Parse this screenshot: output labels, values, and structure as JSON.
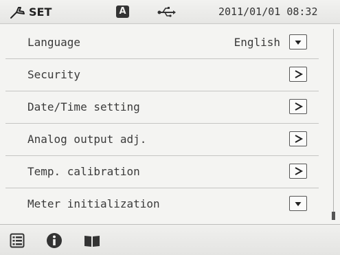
{
  "status_bar": {
    "set_icon": "wrench-icon",
    "title": "SET",
    "mode_badge": "A",
    "usb_icon": "usb-icon",
    "datetime": "2011/01/01 08:32"
  },
  "menu": {
    "items": [
      {
        "label": "Language",
        "value": "English",
        "control_icon": "dropdown-arrow-icon"
      },
      {
        "label": "Security",
        "value": "",
        "control_icon": "chevron-right-icon"
      },
      {
        "label": "Date/Time setting",
        "value": "",
        "control_icon": "chevron-right-icon"
      },
      {
        "label": "Analog output adj.",
        "value": "",
        "control_icon": "chevron-right-icon"
      },
      {
        "label": "Temp. calibration",
        "value": "",
        "control_icon": "chevron-right-icon"
      },
      {
        "label": "Meter initialization",
        "value": "",
        "control_icon": "dropdown-arrow-icon"
      }
    ]
  },
  "bottom_bar": {
    "icons": [
      "list-icon",
      "info-icon",
      "book-icon"
    ]
  },
  "colors": {
    "background": "#f4f4f2",
    "text": "#333333",
    "divider": "#c5c5c3",
    "badge": "#333333"
  }
}
